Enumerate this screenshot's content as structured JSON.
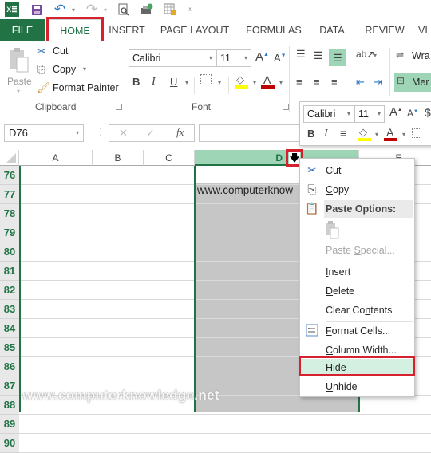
{
  "qat": {
    "icons": [
      "excel-logo-icon",
      "save-icon",
      "undo-icon",
      "redo-icon",
      "print-preview-icon",
      "touch-mode-icon",
      "protect-sheet-icon",
      "customize-qat-icon"
    ]
  },
  "tabs": [
    {
      "label": "FILE"
    },
    {
      "label": "HOME"
    },
    {
      "label": "INSERT"
    },
    {
      "label": "PAGE LAYOUT"
    },
    {
      "label": "FORMULAS"
    },
    {
      "label": "DATA"
    },
    {
      "label": "REVIEW"
    },
    {
      "label": "VI"
    }
  ],
  "ribbon": {
    "clipboard": {
      "paste": "Paste",
      "cut": "Cut",
      "copy": "Copy",
      "format_painter": "Format Painter",
      "label": "Clipboard"
    },
    "font": {
      "font_name": "Calibri",
      "font_size": "11",
      "bold": "B",
      "italic": "I",
      "underline": "U",
      "label": "Font",
      "fill_color": "#ffff00",
      "font_color": "#c00000"
    },
    "alignment": {
      "wrap_text": "Wra",
      "merge": "Mer"
    }
  },
  "formula_bar": {
    "name_box": "D76",
    "cancel": "✕",
    "enter": "✓",
    "fx": "fx",
    "value": ""
  },
  "mini_toolbar": {
    "font_name": "Calibri",
    "font_size": "11",
    "bold": "B",
    "italic": "I"
  },
  "grid": {
    "columns": [
      "A",
      "B",
      "C",
      "D",
      "E"
    ],
    "rows": [
      "76",
      "77",
      "78",
      "79",
      "80",
      "81",
      "82",
      "83",
      "84",
      "85",
      "86",
      "87",
      "88",
      "89",
      "90"
    ],
    "cells": {
      "D77": "www.computerknow"
    },
    "active_cell": "D76",
    "selected_column": "D"
  },
  "context_menu": {
    "items": [
      {
        "label": "Cut",
        "u": "t",
        "icon": "scissors-icon"
      },
      {
        "label": "Copy",
        "u": "C",
        "icon": "copy-icon"
      },
      {
        "label": "Paste Options:",
        "header": true,
        "icon": "paste-icon"
      },
      {
        "label": "Paste Special...",
        "disabled": true
      },
      {
        "label": "Insert"
      },
      {
        "label": "Delete"
      },
      {
        "label": "Clear Contents"
      },
      {
        "label": "Format Cells...",
        "icon": "format-cells-icon"
      },
      {
        "label": "Column Width..."
      },
      {
        "label": "Hide",
        "highlighted": true
      },
      {
        "label": "Unhide"
      }
    ]
  },
  "watermark": "www.computerknowledge.net",
  "colors": {
    "excel_green": "#217346",
    "highlight_red": "#d6212e",
    "selected_header": "#9fd5b7",
    "selection_gray": "#c6c6c6",
    "menu_hover": "#d3f0e0"
  }
}
